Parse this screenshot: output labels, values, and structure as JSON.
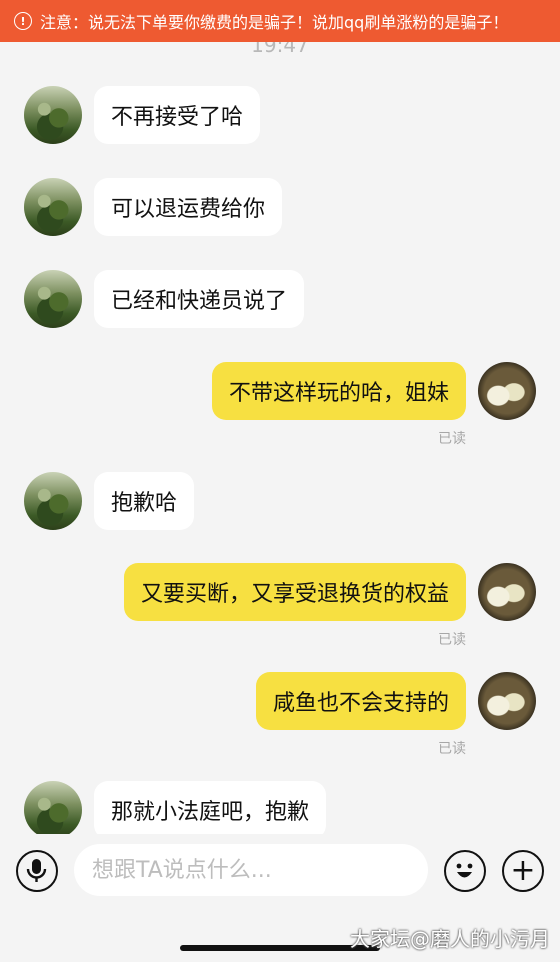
{
  "banner": {
    "icon": "warning-circle-icon",
    "text": "注意：说无法下单要你缴费的是骗子！说加qq刷单涨粉的是骗子！"
  },
  "chat": {
    "timestamp": "19:47",
    "messages": [
      {
        "side": "in",
        "text": "不再接受了哈"
      },
      {
        "side": "in",
        "text": "可以退运费给你"
      },
      {
        "side": "in",
        "text": "已经和快递员说了"
      },
      {
        "side": "out",
        "text": "不带这样玩的哈，姐妹",
        "status": "已读"
      },
      {
        "side": "in",
        "text": "抱歉哈"
      },
      {
        "side": "out",
        "text": "又要买断，又享受退换货的权益",
        "status": "已读"
      },
      {
        "side": "out",
        "text": "咸鱼也不会支持的",
        "status": "已读"
      },
      {
        "side": "in",
        "text": "那就小法庭吧，抱歉"
      }
    ]
  },
  "composer": {
    "voice_icon": "microphone-icon",
    "placeholder": "想跟TA说点什么...",
    "emoji_icon": "smiley-icon",
    "plus_icon": "plus-icon",
    "plus_label": "+"
  },
  "watermark": "大家坛@磨人的小污月",
  "colors": {
    "banner": "#ee5a31",
    "outgoing_bubble": "#f7e041",
    "incoming_bubble": "#ffffff",
    "background": "#f4f4f4"
  }
}
